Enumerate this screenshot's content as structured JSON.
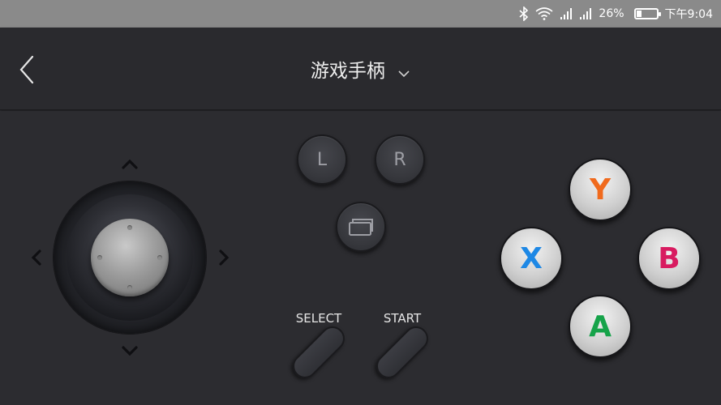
{
  "statusbar": {
    "bluetooth_icon": "bluetooth-icon",
    "wifi_icon": "wifi-icon",
    "signal1_icon": "signal-icon",
    "signal2_icon": "signal-icon",
    "battery_percent": "26%",
    "battery_level": 0.26,
    "time": "下午9:04"
  },
  "header": {
    "title": "游戏手柄",
    "back_icon": "back-chevron-icon",
    "dropdown_icon": "chevron-down-icon"
  },
  "controller": {
    "shoulder_left": "L",
    "shoulder_right": "R",
    "mode_icon": "screen-switch-icon",
    "select_label": "SELECT",
    "start_label": "START",
    "face_buttons": {
      "y": {
        "label": "Y",
        "color": "#f06a1d"
      },
      "x": {
        "label": "X",
        "color": "#1e88e5"
      },
      "b": {
        "label": "B",
        "color": "#d81b60"
      },
      "a": {
        "label": "A",
        "color": "#16a34a"
      }
    }
  },
  "colors": {
    "statusbar_bg": "#8a8a8a",
    "header_bg": "#2a2a2e",
    "pad_bg": "#2c2c30"
  }
}
